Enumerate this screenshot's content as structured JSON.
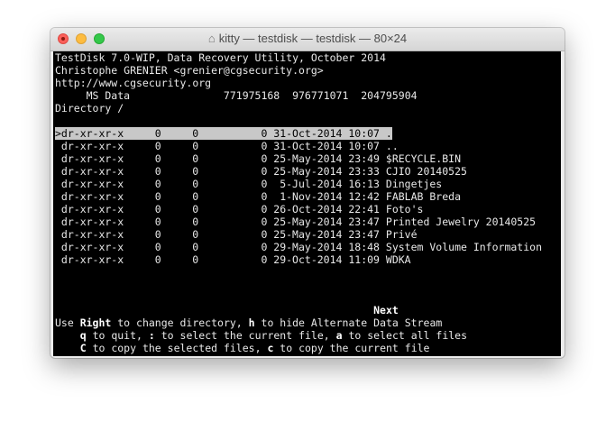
{
  "window": {
    "title": "kitty — testdisk — testdisk — 80×24",
    "icon": "home-icon"
  },
  "header": {
    "line1": "TestDisk 7.0-WIP, Data Recovery Utility, October 2014",
    "line2": "Christophe GRENIER <grenier@cgsecurity.org>",
    "line3": "http://www.cgsecurity.org",
    "partition": {
      "name": "MS Data",
      "start": "771975168",
      "end": "976771071",
      "size": "204795904"
    },
    "directory": "Directory /"
  },
  "files": [
    {
      "marker": ">",
      "perms": "dr-xr-xr-x",
      "uid": "0",
      "gid": "0",
      "size": "0",
      "date": "31-Oct-2014",
      "time": "10:07",
      "name": "."
    },
    {
      "marker": " ",
      "perms": "dr-xr-xr-x",
      "uid": "0",
      "gid": "0",
      "size": "0",
      "date": "31-Oct-2014",
      "time": "10:07",
      "name": ".."
    },
    {
      "marker": " ",
      "perms": "dr-xr-xr-x",
      "uid": "0",
      "gid": "0",
      "size": "0",
      "date": "25-May-2014",
      "time": "23:49",
      "name": "$RECYCLE.BIN"
    },
    {
      "marker": " ",
      "perms": "dr-xr-xr-x",
      "uid": "0",
      "gid": "0",
      "size": "0",
      "date": "25-May-2014",
      "time": "23:33",
      "name": "CJIO 20140525"
    },
    {
      "marker": " ",
      "perms": "dr-xr-xr-x",
      "uid": "0",
      "gid": "0",
      "size": "0",
      "date": " 5-Jul-2014",
      "time": "16:13",
      "name": "Dingetjes"
    },
    {
      "marker": " ",
      "perms": "dr-xr-xr-x",
      "uid": "0",
      "gid": "0",
      "size": "0",
      "date": " 1-Nov-2014",
      "time": "12:42",
      "name": "FABLAB Breda"
    },
    {
      "marker": " ",
      "perms": "dr-xr-xr-x",
      "uid": "0",
      "gid": "0",
      "size": "0",
      "date": "26-Oct-2014",
      "time": "22:41",
      "name": "Foto's"
    },
    {
      "marker": " ",
      "perms": "dr-xr-xr-x",
      "uid": "0",
      "gid": "0",
      "size": "0",
      "date": "25-May-2014",
      "time": "23:47",
      "name": "Printed Jewelry 20140525"
    },
    {
      "marker": " ",
      "perms": "dr-xr-xr-x",
      "uid": "0",
      "gid": "0",
      "size": "0",
      "date": "25-May-2014",
      "time": "23:47",
      "name": "Privé"
    },
    {
      "marker": " ",
      "perms": "dr-xr-xr-x",
      "uid": "0",
      "gid": "0",
      "size": "0",
      "date": "29-May-2014",
      "time": "18:48",
      "name": "System Volume Information"
    },
    {
      "marker": " ",
      "perms": "dr-xr-xr-x",
      "uid": "0",
      "gid": "0",
      "size": "0",
      "date": "29-Oct-2014",
      "time": "11:09",
      "name": "WDKA"
    }
  ],
  "footer": {
    "next": "Next",
    "help1": {
      "a": "Use ",
      "k": "Right",
      "b": " to change directory, ",
      "k2": "h",
      "c": " to hide Alternate Data Stream"
    },
    "help2": {
      "k": "q",
      "a": " to quit, ",
      "k2": ":",
      "b": " to select the current file, ",
      "k3": "a",
      "c": " to select all files"
    },
    "help3": {
      "k": "C",
      "a": " to copy the selected files, ",
      "k2": "c",
      "b": " to copy the current file"
    }
  }
}
